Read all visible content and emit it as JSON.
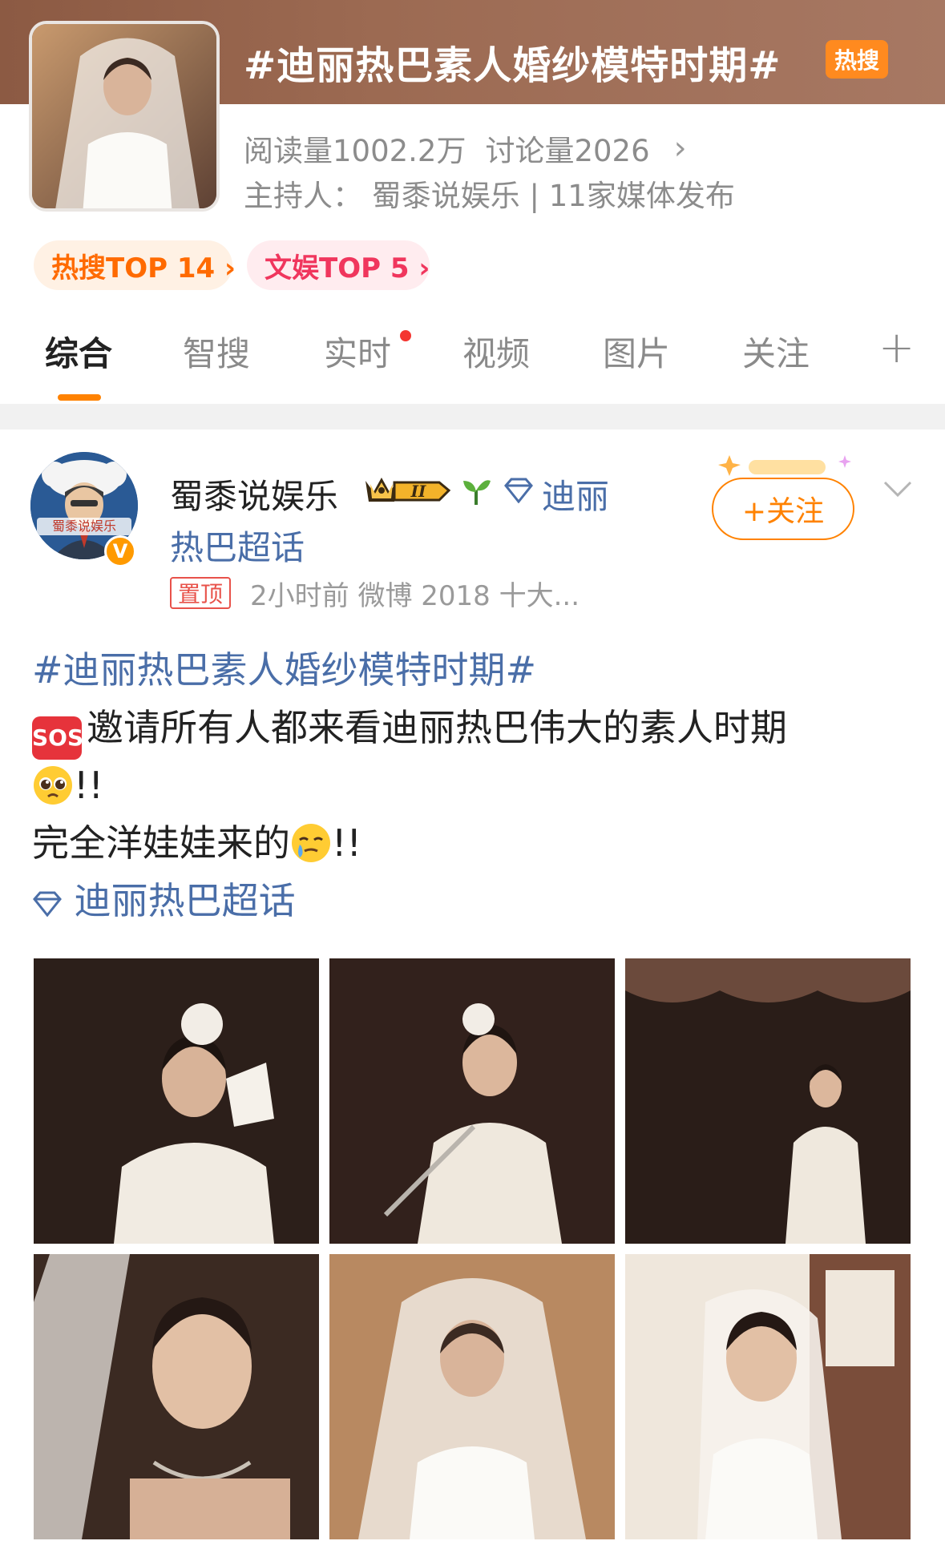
{
  "topic": {
    "title": "#迪丽热巴素人婚纱模特时期#",
    "badge": "热搜",
    "read_count": "阅读量1002.2万",
    "discussion_count": "讨论量2026",
    "host_line": "主持人：  蜀黍说娱乐 | 11家媒体发布",
    "pills": [
      "热搜TOP 14 ›",
      "文娱TOP 5 ›"
    ]
  },
  "tabs": [
    "综合",
    "智搜",
    "实时",
    "视频",
    "图片",
    "关注"
  ],
  "post": {
    "author": "蜀黍说娱乐",
    "level_badge": "II",
    "super_topic_a": "迪丽",
    "super_topic_b": "热巴超话",
    "pinned": "置顶",
    "meta": "2小时前   微博 2018 十大...",
    "follow_label": "+关注",
    "avatar_text": "蜀黍说娱乐",
    "verified": "V",
    "line1": "#迪丽热巴素人婚纱模特时期#",
    "sos": "SOS",
    "line2": "邀请所有人都来看迪丽热巴伟大的素人时期",
    "line3_tail": "!!",
    "line4": "完全洋娃娃来的",
    "line4_tail": "!!",
    "line5": "迪丽热巴超话"
  },
  "colors": {
    "accent": "#ff8200",
    "link": "#4a6ea8",
    "hot_badge": "#ff8a1f",
    "header_bg": "#9c6a52"
  },
  "icons": [
    "chevron-right-icon",
    "plus-icon",
    "crown-icon",
    "sprout-icon",
    "diamond-icon",
    "chevron-down-icon",
    "sos-icon",
    "pleading-face-icon",
    "holding-tears-face-icon"
  ]
}
